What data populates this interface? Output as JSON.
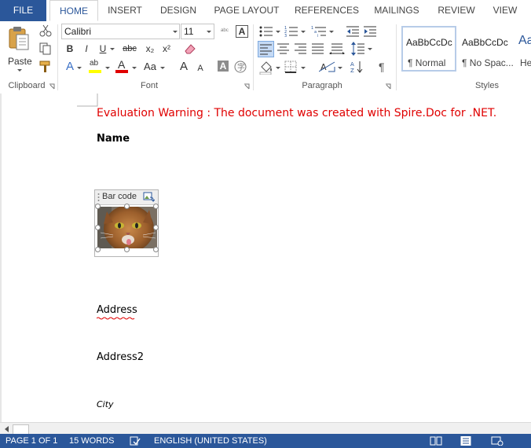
{
  "tabs": [
    {
      "label": "FILE"
    },
    {
      "label": "HOME"
    },
    {
      "label": "INSERT"
    },
    {
      "label": "DESIGN"
    },
    {
      "label": "PAGE LAYOUT"
    },
    {
      "label": "REFERENCES"
    },
    {
      "label": "MAILINGS"
    },
    {
      "label": "REVIEW"
    },
    {
      "label": "VIEW"
    }
  ],
  "ribbon": {
    "clipboard": {
      "label": "Clipboard",
      "paste_label": "Paste"
    },
    "font": {
      "label": "Font",
      "font_name": "Calibri",
      "font_size": "11",
      "bold": "B",
      "italic": "I",
      "underline": "U",
      "strike": "abc",
      "subscript": "x₂",
      "superscript": "x²",
      "grow": "A",
      "shrink": "A",
      "case": "Aa",
      "shade": "A"
    },
    "paragraph": {
      "label": "Paragraph"
    },
    "styles": {
      "label": "Styles",
      "items": [
        {
          "preview": "AaBbCcDc",
          "name": "¶ Normal"
        },
        {
          "preview": "AaBbCcDc",
          "name": "¶ No Spac..."
        },
        {
          "preview": "Aa",
          "name": "He"
        }
      ]
    }
  },
  "document": {
    "warning": "Evaluation Warning : The document was created with Spire.Doc for .NET.",
    "name_label": "Name",
    "image_tag": "Bar code",
    "address": "Address",
    "address2": "Address2",
    "city": "City"
  },
  "status": {
    "page": "PAGE 1 OF 1",
    "words": "15 WORDS",
    "language": "ENGLISH (UNITED STATES)"
  },
  "colors": {
    "accent": "#2b579a",
    "warning": "#e00000",
    "highlight": "#ffff00",
    "font_color": "#e00000"
  }
}
